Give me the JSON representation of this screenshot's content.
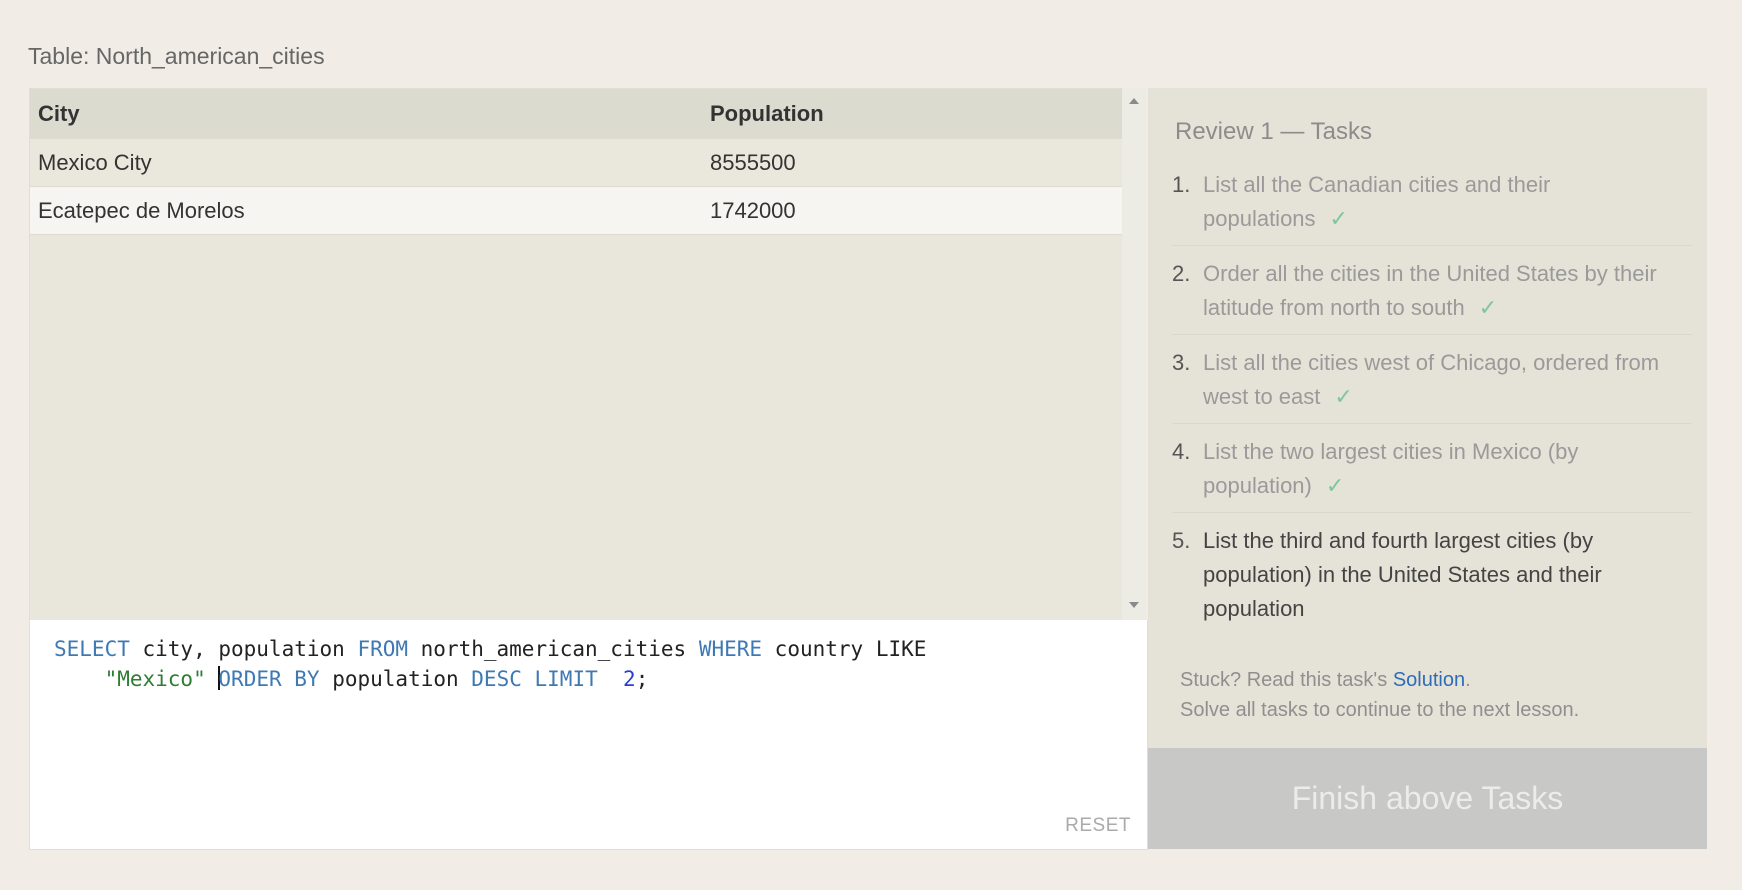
{
  "table_title": "Table: North_american_cities",
  "results": {
    "columns": [
      "City",
      "Population"
    ],
    "rows": [
      [
        "Mexico City",
        "8555500"
      ],
      [
        "Ecatepec de Morelos",
        "1742000"
      ]
    ]
  },
  "editor": {
    "tokens": {
      "select": "SELECT",
      "cols": " city, population ",
      "from": "FROM",
      "table": " north_american_cities ",
      "where": "WHERE",
      "cond": " country LIKE",
      "indent": "    ",
      "str": "\"Mexico\"",
      "space": " ",
      "order_first": "O",
      "order_rest": "RDER BY",
      "by_col": " population ",
      "desc": "DESC",
      "sp2": " ",
      "limit": "LIMIT",
      "sp3": "  ",
      "num": "2",
      "semi": ";"
    },
    "reset_label": "RESET"
  },
  "tasks": {
    "title": "Review 1 — Tasks",
    "items": [
      {
        "num": "1.",
        "text": "List all the Canadian cities and their populations",
        "done": true
      },
      {
        "num": "2.",
        "text": "Order all the cities in the United States by their latitude from north to south",
        "done": true
      },
      {
        "num": "3.",
        "text": "List all the cities west of Chicago, ordered from west to east",
        "done": true
      },
      {
        "num": "4.",
        "text": "List the two largest cities in Mexico (by population)",
        "done": true
      },
      {
        "num": "5.",
        "text": "List the third and fourth largest cities (by population) in the United States and their population",
        "done": false
      }
    ],
    "check_mark": "✓",
    "help_prefix": "Stuck? Read this task's ",
    "help_link": "Solution",
    "help_suffix": ".",
    "help_line2": "Solve all tasks to continue to the next lesson."
  },
  "finish_label": "Finish above Tasks",
  "colors": {
    "background": "#f1ede6",
    "keyword": "#3e79b4",
    "string": "#2e7d32",
    "number": "#2a3fd1",
    "check": "#7ec79c",
    "link": "#2e6db5"
  }
}
